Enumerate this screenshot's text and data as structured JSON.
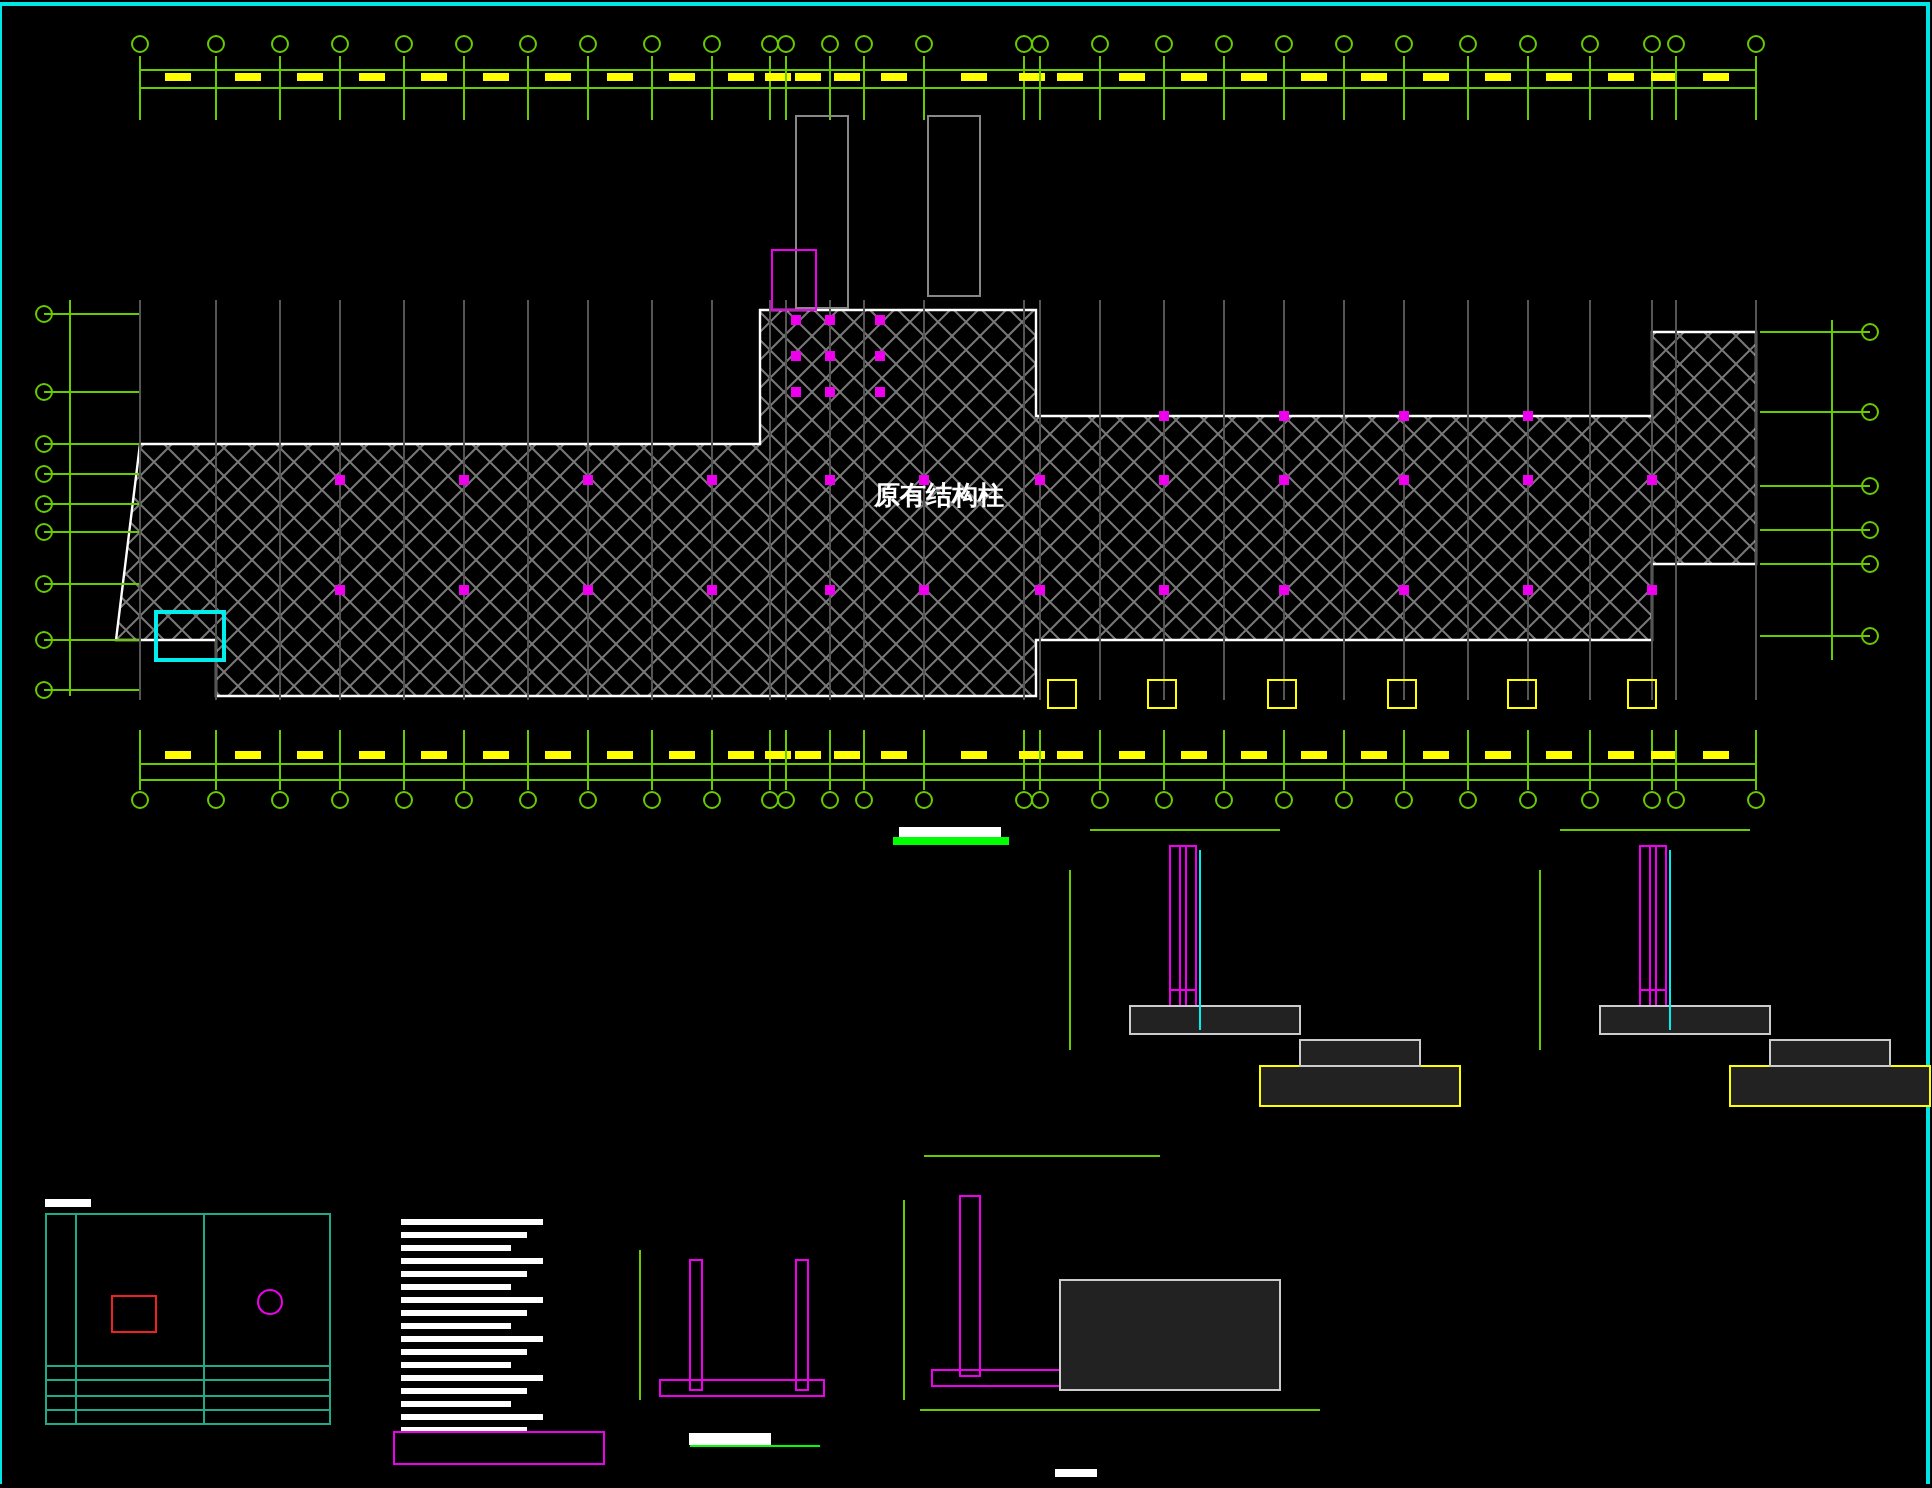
{
  "drawing": {
    "plan_label": "原有结构柱"
  }
}
